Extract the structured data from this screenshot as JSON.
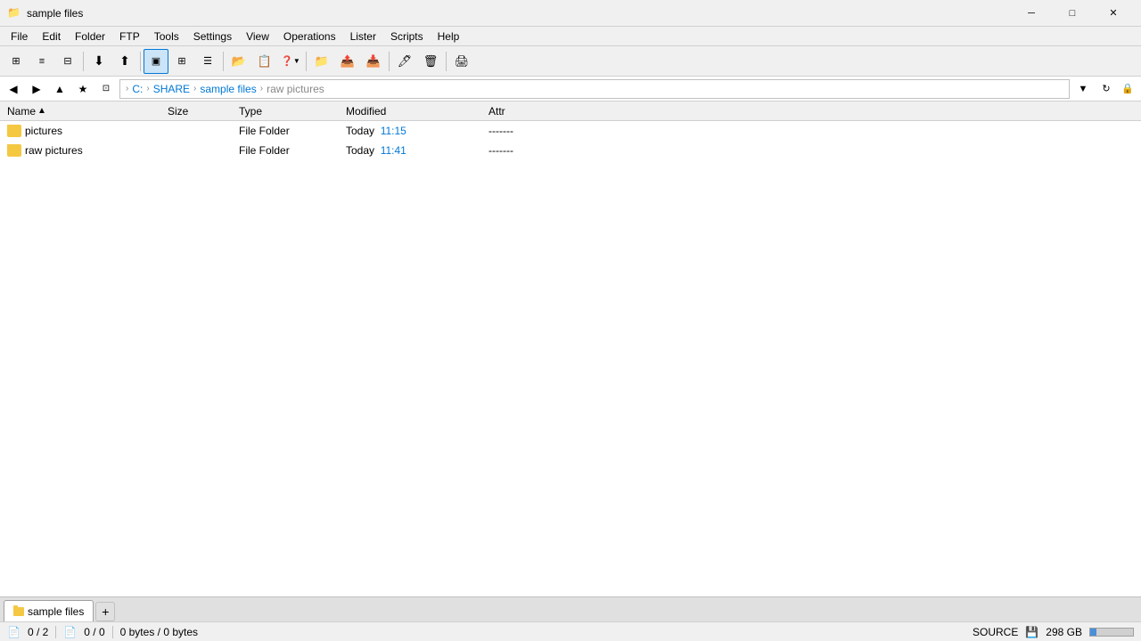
{
  "titleBar": {
    "icon": "📁",
    "title": "sample files",
    "buttons": {
      "minimize": "─",
      "maximize": "□",
      "close": "✕"
    }
  },
  "menuBar": {
    "items": [
      "File",
      "Edit",
      "Folder",
      "FTP",
      "Tools",
      "Settings",
      "View",
      "Operations",
      "Lister",
      "Scripts",
      "Help"
    ]
  },
  "toolbar": {
    "buttons": [
      {
        "icon": "⊞",
        "name": "brief",
        "active": false
      },
      {
        "icon": "☰",
        "name": "list",
        "active": false
      },
      {
        "icon": "⊟",
        "name": "thumbnails",
        "active": false
      },
      {
        "icon": "⬇",
        "name": "copy-down",
        "active": false
      },
      {
        "icon": "⬆",
        "name": "copy-up",
        "active": false
      },
      {
        "icon": "🗂",
        "name": "panel1",
        "active": false
      },
      {
        "icon": "📋",
        "name": "panel2",
        "active": true
      },
      {
        "icon": "❓",
        "name": "help-btn",
        "active": false
      },
      {
        "sep": true
      },
      {
        "icon": "📁",
        "name": "open-folder",
        "active": false
      },
      {
        "icon": "📤",
        "name": "copy-out",
        "active": false
      },
      {
        "icon": "📁",
        "name": "new-folder-btn",
        "active": false
      },
      {
        "sep": true
      },
      {
        "icon": "📥",
        "name": "download",
        "active": false
      },
      {
        "icon": "📊",
        "name": "stats",
        "active": false
      },
      {
        "sep": true
      },
      {
        "icon": "🖨",
        "name": "print",
        "active": false
      }
    ]
  },
  "addressBar": {
    "back": "◀",
    "forward": "▶",
    "up": "▲",
    "bookmark": "★",
    "pathIcon": "⊡",
    "segments": [
      {
        "label": "C:",
        "clickable": true
      },
      {
        "label": "SHARE",
        "clickable": true
      },
      {
        "label": "sample files",
        "clickable": true
      }
    ],
    "current": "raw pictures",
    "dropdownIcon": "▼",
    "refreshIcon": "↻",
    "lockIcon": "🔒"
  },
  "fileListHeader": {
    "columns": [
      {
        "label": "Name",
        "sortIcon": "▲",
        "key": "name"
      },
      {
        "label": "Size",
        "key": "size"
      },
      {
        "label": "Type",
        "key": "type"
      },
      {
        "label": "Modified",
        "key": "modified"
      },
      {
        "label": "Attr",
        "key": "attr"
      }
    ]
  },
  "files": [
    {
      "name": "pictures",
      "size": "",
      "type": "File Folder",
      "modifiedDate": "Today",
      "modifiedTime": "11:15",
      "attr": "-------"
    },
    {
      "name": "raw pictures",
      "size": "",
      "type": "File Folder",
      "modifiedDate": "Today",
      "modifiedTime": "11:41",
      "attr": "-------"
    }
  ],
  "tabs": [
    {
      "label": "sample files",
      "active": true
    }
  ],
  "tabAdd": "+",
  "statusBar": {
    "leftCount": "0 / 2",
    "leftIcon": "📄",
    "rightCount": "0 / 0",
    "rightIcon": "📄",
    "bytes": "0 bytes / 0 bytes",
    "sourceLabel": "SOURCE",
    "driveIcon": "💾",
    "driveSize": "298 GB",
    "driveUsedPercent": 15
  }
}
